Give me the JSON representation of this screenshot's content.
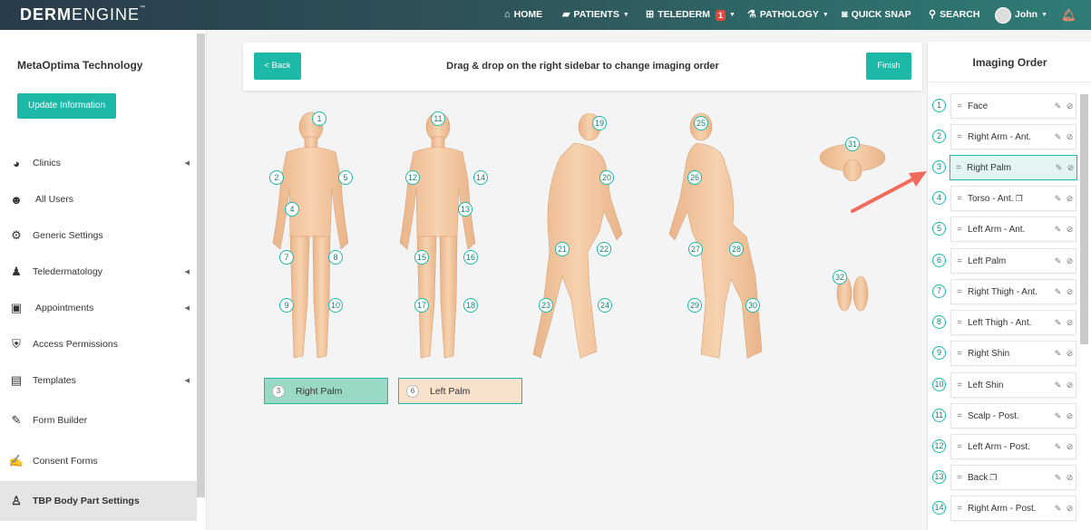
{
  "brand": {
    "name_bold": "DERM",
    "name_light": "ENGINE",
    "tm": "™"
  },
  "nav": {
    "home": "HOME",
    "patients": "PATIENTS",
    "telederm": "TELEDERM",
    "telederm_badge": "1",
    "pathology": "PATHOLOGY",
    "quick_snap": "QUICK SNAP",
    "search": "SEARCH",
    "user": "John"
  },
  "sidebar": {
    "org_name": "MetaOptima Technology",
    "update_button": "Update Information",
    "items": [
      {
        "label": "Clinics",
        "icon": "pie-chart-icon",
        "caret": true
      },
      {
        "label": "All Users",
        "icon": "users-icon",
        "caret": false
      },
      {
        "label": "Generic Settings",
        "icon": "gear-icon",
        "caret": false
      },
      {
        "label": "Teledermatology",
        "icon": "user-link-icon",
        "caret": true
      },
      {
        "label": "Appointments",
        "icon": "calendar-icon",
        "caret": true
      },
      {
        "label": "Access Permissions",
        "icon": "shield-user-icon",
        "caret": false
      },
      {
        "label": "Templates",
        "icon": "document-icon",
        "caret": true
      },
      {
        "label": "Form Builder",
        "icon": "form-edit-icon",
        "caret": false
      },
      {
        "label": "Consent Forms",
        "icon": "consent-form-icon",
        "caret": false
      },
      {
        "label": "TBP Body Part Settings",
        "icon": "body-figure-icon",
        "caret": false,
        "active": true
      }
    ]
  },
  "header": {
    "back": "< Back",
    "title": "Drag & drop on the right sidebar to change imaging order",
    "finish": "Finish"
  },
  "markers": [
    "1",
    "2",
    "3",
    "4",
    "5",
    "6",
    "7",
    "8",
    "9",
    "10",
    "11",
    "12",
    "13",
    "14",
    "15",
    "16",
    "17",
    "18",
    "19",
    "20",
    "21",
    "22",
    "23",
    "24",
    "25",
    "26",
    "27",
    "28",
    "29",
    "30",
    "31",
    "32"
  ],
  "selected": [
    {
      "num": "3",
      "label": "Right Palm",
      "color": "#9bd9c7"
    },
    {
      "num": "6",
      "label": "Left Palm",
      "color": "#f9e2cc"
    }
  ],
  "imaging_order": {
    "title": "Imaging Order",
    "items": [
      {
        "num": "1",
        "label": "Face"
      },
      {
        "num": "2",
        "label": "Right Arm - Ant."
      },
      {
        "num": "3",
        "label": "Right Palm",
        "active": true
      },
      {
        "num": "4",
        "label": "Torso - Ant.",
        "copy": true
      },
      {
        "num": "5",
        "label": "Left Arm - Ant."
      },
      {
        "num": "6",
        "label": "Left Palm"
      },
      {
        "num": "7",
        "label": "Right Thigh - Ant."
      },
      {
        "num": "8",
        "label": "Left Thigh - Ant."
      },
      {
        "num": "9",
        "label": "Right Shin"
      },
      {
        "num": "10",
        "label": "Left Shin"
      },
      {
        "num": "11",
        "label": "Scalp - Post."
      },
      {
        "num": "12",
        "label": "Left Arm - Post."
      },
      {
        "num": "13",
        "label": "Back",
        "copy": true
      },
      {
        "num": "14",
        "label": "Right Arm - Post."
      }
    ]
  },
  "colors": {
    "accent": "#1cb8a8",
    "skin": "#f4c9a1",
    "arrow": "#f26a5b"
  }
}
